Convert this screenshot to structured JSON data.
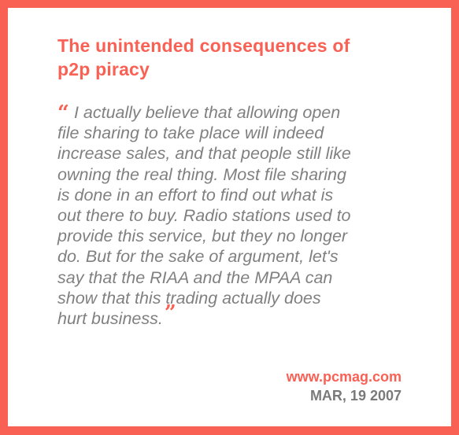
{
  "title": {
    "line1": "The unintended consequences of",
    "line2": "p2p piracy"
  },
  "quote": {
    "open_mark": "“",
    "close_mark": "”",
    "lines": [
      "I actually believe that allowing open",
      "file sharing to take place will indeed",
      "increase sales, and that people still like",
      "owning the real thing. Most file sharing",
      "is done in an effort to find out what is",
      "out there to buy. Radio stations used to",
      "provide this service, but they no longer",
      "do. But for the sake of argument, let's",
      "say that the RIAA and the MPAA can",
      "show that this trading actually does",
      "hurt business."
    ]
  },
  "source": {
    "url": "www.pcmag.com",
    "date": "MAR, 19 2007"
  },
  "colors": {
    "accent": "#f96155",
    "text": "#808080"
  }
}
